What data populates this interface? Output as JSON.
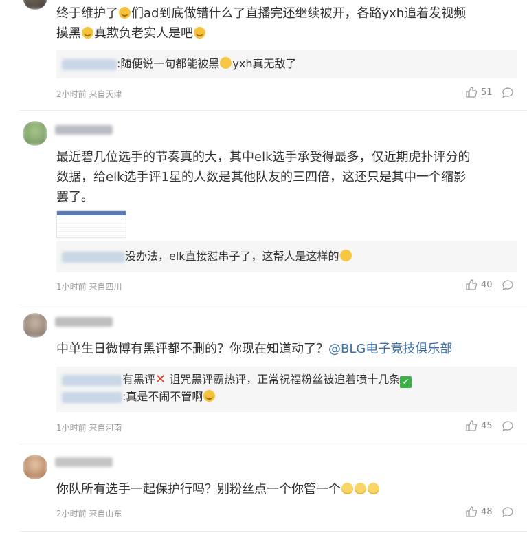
{
  "comments": [
    {
      "text": "终于维护了",
      "text_emoji": "cry",
      "text2": "们ad到底做错什么了直播完还继续被开，各路yxh追着发视频",
      "line2_a": "摸黑",
      "line2_emoji": "cry",
      "line2_b": "真欺负老实人是吧",
      "line2_emoji2": "cry",
      "reply": ":随便说一句都能被黑",
      "reply_emoji": "laugh",
      "reply_tail": "yxh真无敌了",
      "meta": "2小时前 来自天津",
      "likes": "51"
    },
    {
      "line1": "最近碧几位选手的节奏真的大，其中elk选手承受得最多，仅近期虎扑评分的",
      "line2": "数据，给elk选手评1星的人数是其他队友的三四倍，这还只是其中一个缩影",
      "line3": "罢了。",
      "reply": "没办法，elk直接怼串子了，这帮人是这样的",
      "reply_emoji": "sweat",
      "meta": "1小时前 来自四川",
      "likes": "40"
    },
    {
      "text": "中单生日微博有黑评都不删的？你现在知道动了？",
      "mention": "@BLG电子竞技俱乐部",
      "reply1": "有黑评",
      "reply1_x": "✕",
      "reply1_b": " 诅咒黑评霸热评，正常祝福粉丝被追着喷十几条",
      "reply1_check": "✓",
      "reply2": ":真是不闹不管啊",
      "reply2_emoji": "cry",
      "meta": "1小时前 来自河南",
      "likes": "45"
    },
    {
      "text": "你队所有选手一起保护行吗？别粉丝点一个你管一个",
      "meta": "2小时前 来自山东",
      "likes": "48"
    }
  ],
  "colors": {
    "mention": "#3b6fa8",
    "meta": "#999999",
    "reply_bg": "#f5f5f5"
  }
}
